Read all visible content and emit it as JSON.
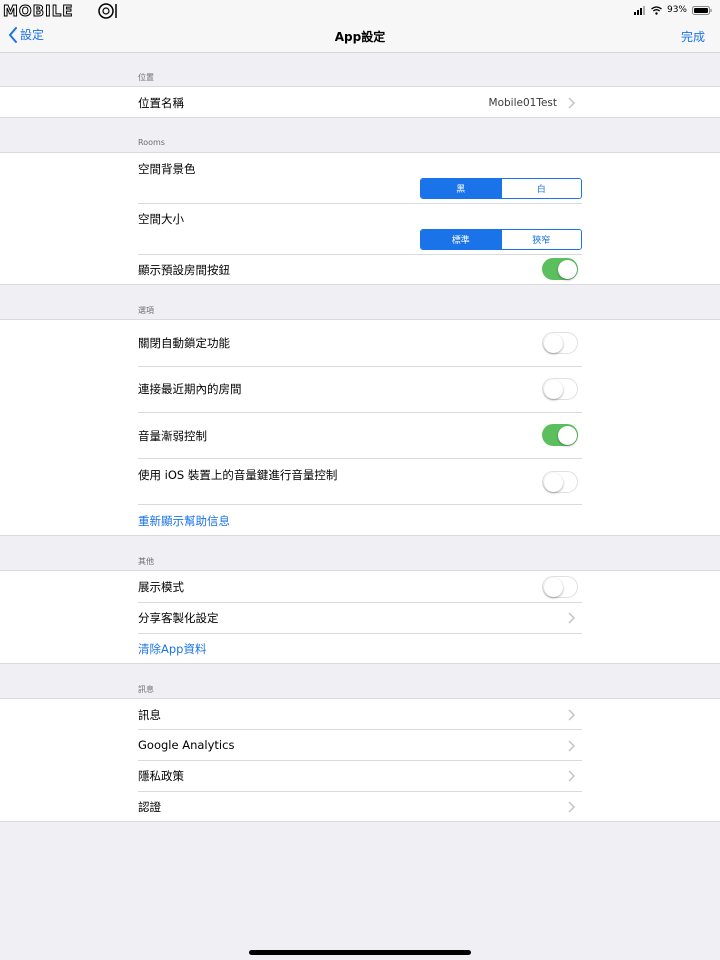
{
  "status_bar": {
    "logo_text": "MOBILE01",
    "battery": "93%"
  },
  "nav": {
    "back_label": "設定",
    "title": "App設定",
    "done_label": "完成"
  },
  "sections": {
    "location": {
      "header": "位置",
      "name_label": "位置名稱",
      "name_value": "Mobile01Test"
    },
    "rooms": {
      "header": "Rooms",
      "bg_color_label": "空間背景色",
      "bg_color_options": [
        "黑",
        "白"
      ],
      "bg_color_selected": "黑",
      "size_label": "空間大小",
      "size_options": [
        "標準",
        "狹窄"
      ],
      "size_selected": "標準",
      "show_default_label": "顯示預設房間按鈕",
      "show_default_on": true
    },
    "options": {
      "header": "選項",
      "auto_lock_label": "關閉自動鎖定功能",
      "auto_lock_on": false,
      "recent_room_label": "連接最近期內的房間",
      "recent_room_on": false,
      "volume_fade_label": "音量漸弱控制",
      "volume_fade_on": true,
      "ios_volume_label": "使用 iOS 裝置上的音量鍵進行音量控制",
      "ios_volume_on": false,
      "reshow_help_label": "重新顯示幫助信息"
    },
    "other": {
      "header": "其他",
      "demo_mode_label": "展示模式",
      "demo_mode_on": false,
      "share_label": "分享客製化設定",
      "clear_label": "清除App資料"
    },
    "info": {
      "header": "訊息",
      "items": [
        "訊息",
        "Google Analytics",
        "隱私政策",
        "認證"
      ]
    }
  },
  "colors": {
    "accent": "#1a73e8",
    "toggle_on": "#5bbf5e",
    "background": "#efeff4"
  }
}
